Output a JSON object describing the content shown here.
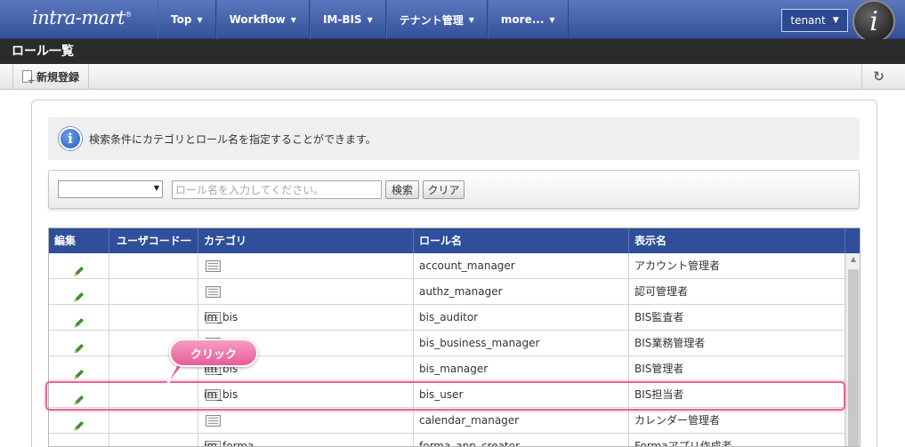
{
  "header": {
    "logo": "intra-mart",
    "logo_reg": "®",
    "nav": [
      {
        "label": "Top"
      },
      {
        "label": "Workflow"
      },
      {
        "label": "IM-BIS"
      },
      {
        "label": "テナント管理"
      },
      {
        "label": "more..."
      }
    ],
    "tenant_label": "tenant",
    "avatar_letter": "i"
  },
  "page": {
    "title": "ロール一覧"
  },
  "toolbar": {
    "new_label": "新規登録"
  },
  "info": {
    "message": "検索条件にカテゴリとロール名を指定することができます。"
  },
  "search": {
    "category_selected": "",
    "role_placeholder": "ロール名を入力してください。",
    "search_label": "検索",
    "clear_label": "クリア"
  },
  "grid": {
    "columns": [
      "編集",
      "ユーザコード一覧",
      "カテゴリ",
      "ロール名",
      "表示名"
    ],
    "rows": [
      {
        "category": "",
        "role": "account_manager",
        "display": "アカウント管理者"
      },
      {
        "category": "",
        "role": "authz_manager",
        "display": "認可管理者"
      },
      {
        "category": "im_bis",
        "role": "bis_auditor",
        "display": "BIS監査者"
      },
      {
        "category": "",
        "role": "bis_business_manager",
        "display": "BIS業務管理者"
      },
      {
        "category": "im_bis",
        "role": "bis_manager",
        "display": "BIS管理者"
      },
      {
        "category": "im_bis",
        "role": "bis_user",
        "display": "BIS担当者"
      },
      {
        "category": "",
        "role": "calendar_manager",
        "display": "カレンダー管理者"
      },
      {
        "category": "im_forma",
        "role": "forma_app_creator",
        "display": "Formaアプリ作成者"
      }
    ]
  },
  "annotation": {
    "callout_label": "クリック",
    "color": "#e8659a"
  },
  "colors": {
    "header_blue": "#34519b",
    "title_bar": "#2b2b2b",
    "grid_header": "#2f4f9a"
  }
}
